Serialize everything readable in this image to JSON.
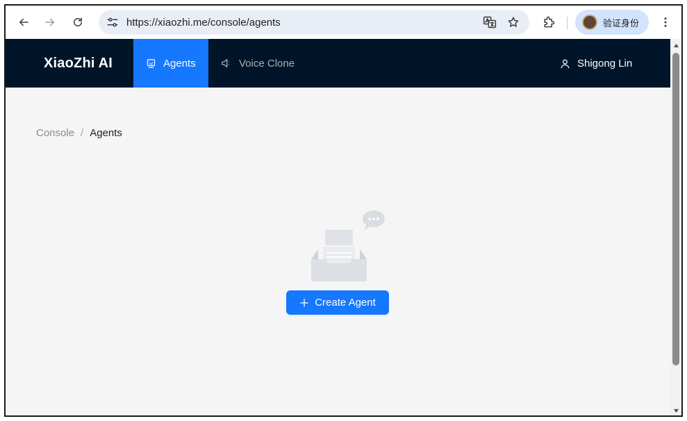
{
  "browser": {
    "url": "https://xiaozhi.me/console/agents",
    "profile_label": "验证身份"
  },
  "header": {
    "brand": "XiaoZhi AI",
    "menu": [
      {
        "label": "Agents",
        "active": true
      },
      {
        "label": "Voice Clone",
        "active": false
      }
    ],
    "user_name": "Shigong Lin"
  },
  "breadcrumb": {
    "items": [
      "Console",
      "Agents"
    ],
    "separator": "/"
  },
  "empty_state": {
    "button_label": "Create Agent"
  },
  "colors": {
    "header_bg": "#001529",
    "accent": "#1677ff",
    "content_bg": "#f5f5f5",
    "omnibox_bg": "#e9eef6",
    "profile_bg": "#d3e3fd"
  },
  "icons": {
    "back": "arrow-left-icon",
    "forward": "arrow-right-icon",
    "reload": "reload-icon",
    "site_info": "tune-icon",
    "translate": "translate-icon",
    "bookmark": "star-icon",
    "extensions": "puzzle-icon",
    "menu": "kebab-icon",
    "agents": "robot-icon",
    "voice": "speaker-icon",
    "user": "user-icon",
    "plus": "plus-icon"
  }
}
